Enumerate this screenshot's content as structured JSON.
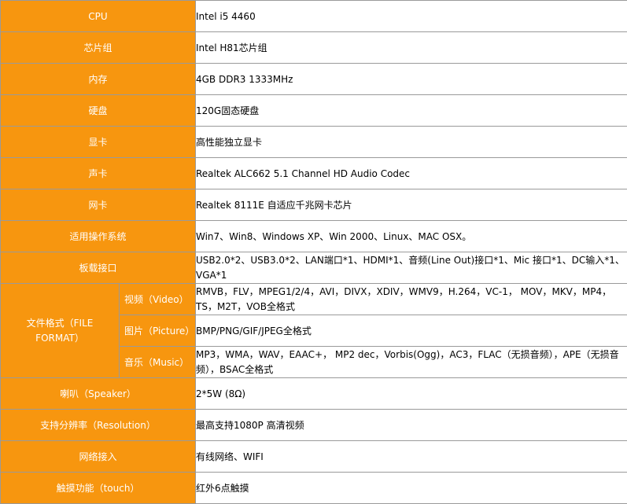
{
  "rows": [
    {
      "label": "CPU",
      "value": "Intel i5 4460"
    },
    {
      "label": "芯片组",
      "value": "Intel H81芯片组"
    },
    {
      "label": "内存",
      "value": "4GB DDR3 1333MHz"
    },
    {
      "label": "硬盘",
      "value": "120G固态硬盘"
    },
    {
      "label": "显卡",
      "value": "高性能独立显卡"
    },
    {
      "label": "声卡",
      "value": "Realtek ALC662 5.1 Channel HD Audio Codec"
    },
    {
      "label": "网卡",
      "value": "Realtek 8111E 自适应千兆网卡芯片"
    },
    {
      "label": "适用操作系统",
      "value": "Win7、Win8、Windows XP、Win 2000、Linux、MAC OSX。"
    },
    {
      "label": "板载接口",
      "value": "USB2.0*2、USB3.0*2、LAN端口*1、HDMI*1、音频(Line Out)接口*1、Mic 接口*1、DC输入*1、VGA*1"
    }
  ],
  "file_format": {
    "label_line1": "文件格式（FILE",
    "label_line2": "FORMAT）",
    "subrows": [
      {
        "label": "视频（Video）",
        "value": "RMVB，FLV，MPEG1/2/4，AVI，DIVX，XDIV，WMV9，H.264，VC-1， MOV，MKV，MP4，TS，M2T，VOB全格式"
      },
      {
        "label": "图片（Picture）",
        "value": "BMP/PNG/GIF/JPEG全格式"
      },
      {
        "label": "音乐（Music）",
        "value": "MP3，WMA，WAV，EAAC+， MP2 dec，Vorbis(Ogg)，AC3，FLAC（无损音频），APE（无损音频），BSAC全格式"
      }
    ]
  },
  "rows_after": [
    {
      "label": "喇叭（Speaker）",
      "value": "2*5W (8Ω)"
    },
    {
      "label": "支持分辨率（Resolution）",
      "value": "最高支持1080P 高清视频"
    },
    {
      "label": "网络接入",
      "value": "有线网络、WIFI"
    },
    {
      "label": "触摸功能（touch）",
      "value": "红外6点触摸"
    }
  ],
  "colors": {
    "label_bg": "#f7960f",
    "label_text": "#ffffff",
    "border": "#9a9a9a"
  }
}
